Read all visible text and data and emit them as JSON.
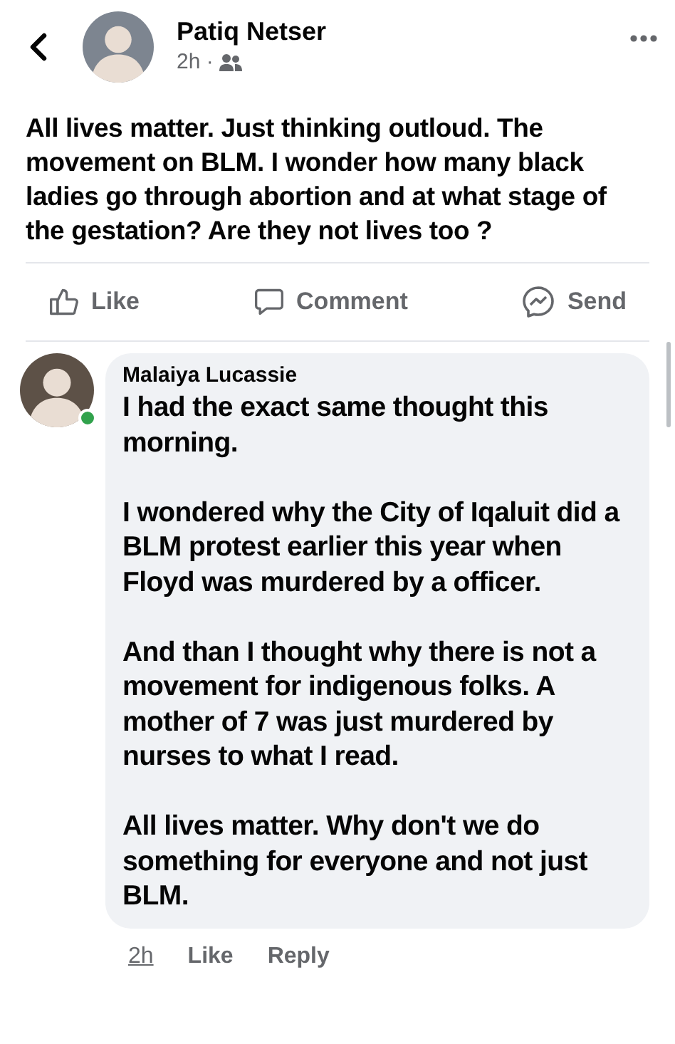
{
  "post": {
    "author": "Patiq Netser",
    "time": "2h ·",
    "friends_only": true,
    "text": "All lives matter. Just thinking outloud. The movement on BLM. I wonder how many black ladies go through abortion and at what stage of the gestation? Are they not lives too ?"
  },
  "actions": [
    {
      "kind": "like",
      "label": "Like"
    },
    {
      "kind": "comment",
      "label": "Comment"
    },
    {
      "kind": "send",
      "label": "Send"
    }
  ],
  "comment": {
    "author": "Malaiya Lucassie",
    "online": true,
    "paragraphs": [
      "I had the exact same thought this morning.",
      "I wondered why the City of Iqaluit did a BLM protest earlier this year when Floyd was murdered by a officer.",
      "And than I thought why there is not a movement for indigenous folks. A mother of 7 was just murdered by nurses to what I read.",
      "All lives matter. Why don't we do something for everyone and not just BLM."
    ],
    "footer": [
      {
        "kind": "time",
        "label": "2h"
      },
      {
        "kind": "action",
        "label": "Like"
      },
      {
        "kind": "action",
        "label": "Reply"
      }
    ]
  }
}
